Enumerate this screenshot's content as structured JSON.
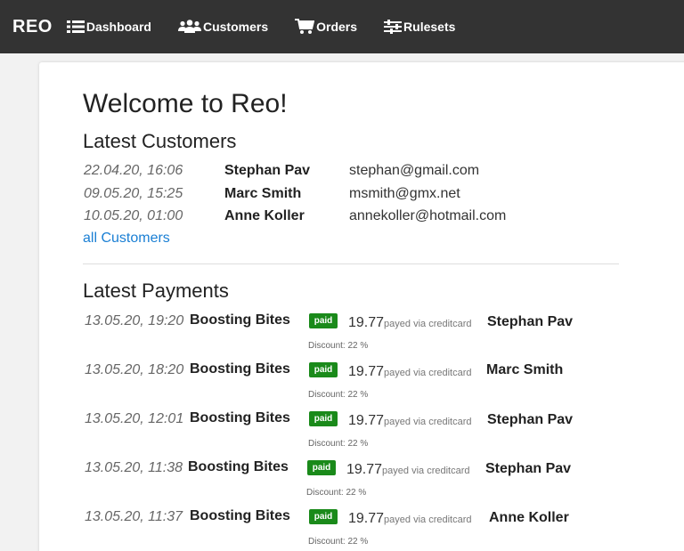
{
  "nav": {
    "brand": "REO",
    "items": [
      {
        "label": "Dashboard",
        "icon": "list-icon"
      },
      {
        "label": "Customers",
        "icon": "users-icon"
      },
      {
        "label": "Orders",
        "icon": "cart-icon"
      },
      {
        "label": "Rulesets",
        "icon": "sliders-icon"
      }
    ]
  },
  "colors": {
    "navbar": "#333333",
    "link": "#1a7fd4",
    "paid_badge": "#1a8a1a"
  },
  "page": {
    "title": "Welcome to Reo!"
  },
  "customers": {
    "title": "Latest Customers",
    "rows": [
      {
        "date": "22.04.20, 16:06",
        "name": "Stephan Pav",
        "email": "stephan@gmail.com"
      },
      {
        "date": "09.05.20, 15:25",
        "name": "Marc Smith",
        "email": "msmith@gmx.net"
      },
      {
        "date": "10.05.20, 01:00",
        "name": "Anne Koller",
        "email": "annekoller@hotmail.com"
      }
    ],
    "all_link": "all Customers"
  },
  "payments": {
    "title": "Latest Payments",
    "rows": [
      {
        "date": "13.05.20, 19:20",
        "product": "Boosting Bites",
        "status": "paid",
        "amount": "19.77",
        "via": "payed via creditcard",
        "customer": "Stephan Pav",
        "discount": "Discount: 22 %"
      },
      {
        "date": "13.05.20, 18:20",
        "product": "Boosting Bites",
        "status": "paid",
        "amount": "19.77",
        "via": "payed via creditcard",
        "customer": "Marc Smith",
        "discount": "Discount: 22 %"
      },
      {
        "date": "13.05.20, 12:01",
        "product": "Boosting Bites",
        "status": "paid",
        "amount": "19.77",
        "via": "payed via creditcard",
        "customer": "Stephan Pav",
        "discount": "Discount: 22 %"
      },
      {
        "date": "13.05.20, 11:38",
        "product": "Boosting Bites",
        "status": "paid",
        "amount": "19.77",
        "via": "payed via creditcard",
        "customer": "Stephan Pav",
        "discount": "Discount: 22 %"
      },
      {
        "date": "13.05.20, 11:37",
        "product": "Boosting Bites",
        "status": "paid",
        "amount": "19.77",
        "via": "payed via creditcard",
        "customer": "Anne Koller",
        "discount": "Discount: 22 %"
      }
    ]
  }
}
